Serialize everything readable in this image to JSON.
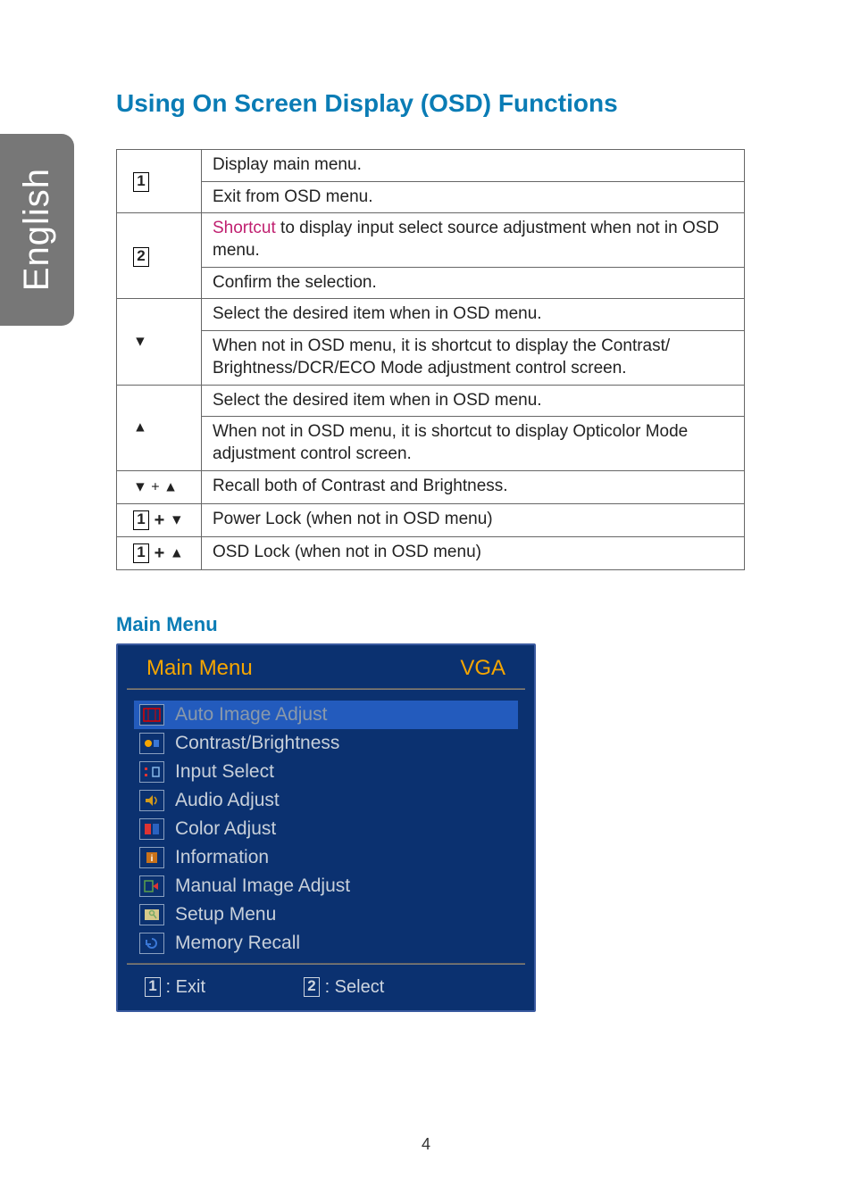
{
  "side_tab": "English",
  "page_title": "Using On Screen Display (OSD) Functions",
  "table": {
    "row1_key_num": "1",
    "row1a": "Display main menu.",
    "row1b": "Exit from OSD menu.",
    "row2_key_num": "2",
    "row2a_prefix": "Shortcut",
    "row2a_rest": " to display input select source adjustment when not in OSD menu.",
    "row2b": "Confirm the selection.",
    "row3_key": "▼",
    "row3a": "Select the desired item when in OSD menu.",
    "row3b": "When not in OSD menu, it is shortcut to display the Contrast/ Brightness/DCR/ECO Mode adjustment control screen.",
    "row4_key": "▲",
    "row4a": "Select the desired item when in OSD menu.",
    "row4b": "When not in OSD menu, it is shortcut to display Opticolor Mode adjustment control screen.",
    "row5_key": "▼ + ▲",
    "row5": "Recall both of Contrast and Brightness.",
    "row6_key_num": "1",
    "row6_key_tri": "▼",
    "row6": "Power Lock (when not in OSD menu)",
    "row7_key_num": "1",
    "row7_key_tri": "▲",
    "row7": "OSD Lock (when not in OSD menu)"
  },
  "section_title": "Main Menu",
  "osd": {
    "title": "Main Menu",
    "source": "VGA",
    "items": [
      {
        "label": "Auto Image Adjust",
        "selected": true
      },
      {
        "label": "Contrast/Brightness",
        "selected": false
      },
      {
        "label": "Input Select",
        "selected": false
      },
      {
        "label": "Audio Adjust",
        "selected": false
      },
      {
        "label": "Color Adjust",
        "selected": false
      },
      {
        "label": "Information",
        "selected": false
      },
      {
        "label": "Manual Image Adjust",
        "selected": false
      },
      {
        "label": "Setup Menu",
        "selected": false
      },
      {
        "label": "Memory Recall",
        "selected": false
      }
    ],
    "footer_exit_num": "1",
    "footer_exit_label": " : Exit",
    "footer_select_num": "2",
    "footer_select_label": " : Select"
  },
  "page_number": "4"
}
